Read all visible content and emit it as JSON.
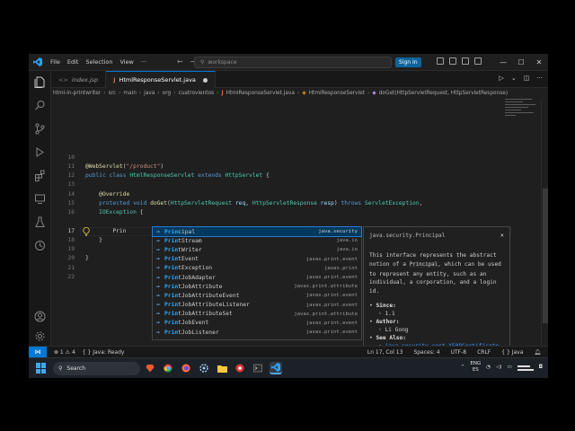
{
  "titlebar": {
    "menu": [
      "File",
      "Edit",
      "Selection",
      "View"
    ],
    "more": "···",
    "search_placeholder": "workspace",
    "signin_label": "Sign In"
  },
  "tabs": [
    {
      "label": "index.jsp",
      "active": false
    },
    {
      "label": "HtmlResponseServlet.java",
      "active": true
    }
  ],
  "breadcrumb": [
    "html-in-printwriter",
    "src",
    "main",
    "java",
    "org",
    "cuatrovientos",
    "HtmlResponseServlet.java",
    "HtmlResponseServlet",
    "doGet(HttpServletRequest, HttpServletResponse)"
  ],
  "editor": {
    "line_numbers": [
      "10",
      "11",
      "12",
      "13",
      "14",
      "15",
      "16",
      "17",
      "18",
      "19",
      "20",
      "21",
      "22"
    ],
    "typed_text": "Prin"
  },
  "suggestions": [
    {
      "prefix": "Prin",
      "rest": "cipal",
      "detail": "java.security",
      "selected": true
    },
    {
      "prefix": "Prin",
      "rest": "tStream",
      "detail": "java.io"
    },
    {
      "prefix": "Prin",
      "rest": "tWriter",
      "detail": "java.io"
    },
    {
      "prefix": "Prin",
      "rest": "tEvent",
      "detail": "javax.print.event"
    },
    {
      "prefix": "Prin",
      "rest": "tException",
      "detail": "javax.print"
    },
    {
      "prefix": "Prin",
      "rest": "tJobAdapter",
      "detail": "javax.print.event"
    },
    {
      "prefix": "Prin",
      "rest": "tJobAttribute",
      "detail": "javax.print.attribute"
    },
    {
      "prefix": "Prin",
      "rest": "tJobAttributeEvent",
      "detail": "javax.print.event"
    },
    {
      "prefix": "Prin",
      "rest": "tJobAttributeListener",
      "detail": "javax.print.event"
    },
    {
      "prefix": "Prin",
      "rest": "tJobAttributeSet",
      "detail": "javax.print.attribute"
    },
    {
      "prefix": "Prin",
      "rest": "tJobEvent",
      "detail": "javax.print.event"
    },
    {
      "prefix": "Prin",
      "rest": "tJobListener",
      "detail": "javax.print.event"
    }
  ],
  "details": {
    "title": "java.security.Principal",
    "body_pre": "This interface represents the abstract notion of a ",
    "body_code": "Principal",
    "body_post": ", which can be used to represent any entity, such as an individual, a corporation, and a login id.",
    "since_label": "Since:",
    "since_value": "1.1",
    "author_label": "Author:",
    "author_value": "Li Gong",
    "see_label": "See Also:",
    "see_value": "java.security.cert.X509Certificate"
  },
  "statusbar": {
    "problems": "⊗ 1 ⚠ 4",
    "java": "{ } Java: Ready",
    "position": "Ln 17, Col 13",
    "spaces": "Spaces: 4",
    "encoding": "UTF-8",
    "eol": "CRLF",
    "language": "{ } Java"
  },
  "taskbar": {
    "search_label": "Search",
    "lang_top": "ENG",
    "lang_bottom": "ES"
  },
  "colors": {
    "accent": "#0078d4",
    "editor_bg": "#1f1f1f",
    "keyword": "#569cd6",
    "type": "#4ec9b0",
    "string": "#ce9178"
  }
}
